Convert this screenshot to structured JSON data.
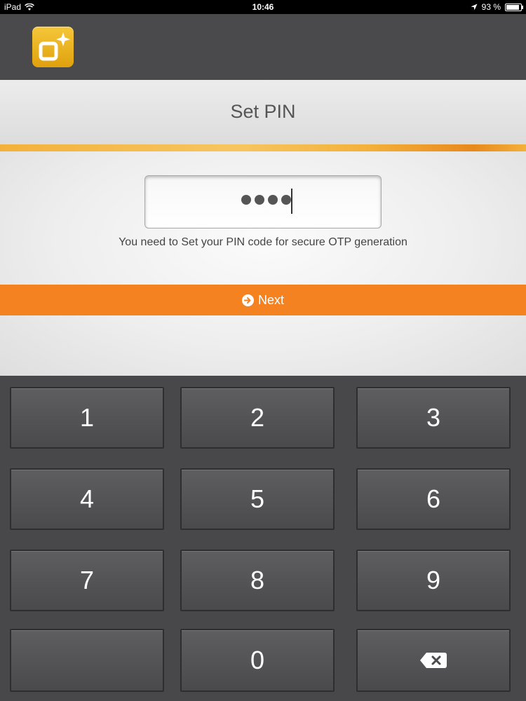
{
  "status_bar": {
    "device": "iPad",
    "time": "10:46",
    "battery": "93 %"
  },
  "header": {
    "logo_icon": "app-logo-icon"
  },
  "title": "Set PIN",
  "pin_input": {
    "masked_value": "••••",
    "digits_entered": 4
  },
  "hint": "You need to Set your PIN code for secure OTP generation",
  "next_button": {
    "label": "Next",
    "icon": "arrow-circle-right-icon"
  },
  "keypad": {
    "keys": [
      "1",
      "2",
      "3",
      "4",
      "5",
      "6",
      "7",
      "8",
      "9",
      "",
      "0",
      "backspace"
    ]
  },
  "colors": {
    "accent": "#f58220",
    "header_bg": "#4a4a4c",
    "stripe": "#f3b13a"
  }
}
